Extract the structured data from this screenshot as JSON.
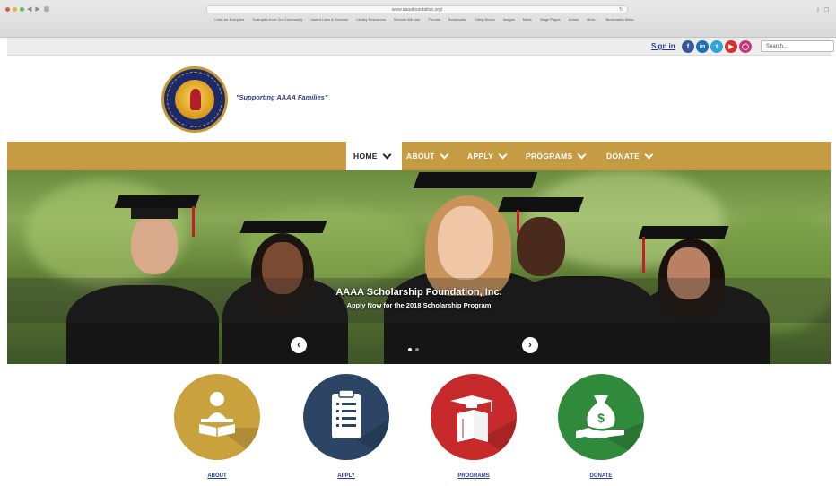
{
  "browser": {
    "address": "www.aaaafoundation.org/",
    "bookmarks": [
      "Links for Everyone",
      "Examples from Our Community",
      "Useful Links & Services",
      "Library Resources",
      "Schools We Like",
      "Forums",
      "Bookmarks",
      "Citing Works",
      "Images",
      "News",
      "Stage Pages",
      "Admin",
      "More...",
      "Bookmarks Menu"
    ]
  },
  "topbar": {
    "signin_label": "Sign in",
    "socials": [
      "facebook-icon",
      "linkedin-icon",
      "twitter-icon",
      "youtube-icon",
      "instagram-icon"
    ],
    "search_placeholder": "Search..."
  },
  "header": {
    "tagline": "\"Supporting AAAA Families\"",
    "logo_name": "AAAA Families seal"
  },
  "nav": {
    "items": [
      {
        "label": "HOME"
      },
      {
        "label": "ABOUT"
      },
      {
        "label": "APPLY"
      },
      {
        "label": "PROGRAMS"
      },
      {
        "label": "DONATE"
      }
    ]
  },
  "hero": {
    "title": "AAAA Scholarship Foundation, Inc.",
    "subtitle": "Apply Now for the 2018 Scholarship Program",
    "slide_count": 2,
    "active_slide": 1
  },
  "features": [
    {
      "label": "ABOUT",
      "icon": "reader-book-icon",
      "color": "#c9a13d"
    },
    {
      "label": "APPLY",
      "icon": "clipboard-icon",
      "color": "#2c4565"
    },
    {
      "label": "PROGRAMS",
      "icon": "graduation-books-icon",
      "color": "#c62a2a"
    },
    {
      "label": "DONATE",
      "icon": "money-bag-hand-icon",
      "color": "#2f8a3c"
    }
  ],
  "colors": {
    "nav_gold": "#c59b44",
    "brand_blue": "#2b3d8c"
  }
}
